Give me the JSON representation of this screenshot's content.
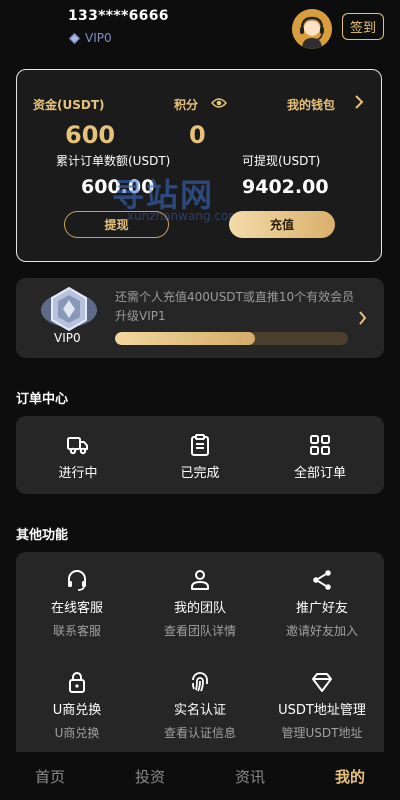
{
  "header": {
    "phone": "133****6666",
    "vip_level": "VIP0",
    "signin_label": "签到"
  },
  "assets": {
    "funds_label": "资金(USDT)",
    "funds_value": "600",
    "points_label": "积分",
    "points_value": "0",
    "wallet_label": "我的钱包",
    "total_orders_label": "累计订单数额(USDT)",
    "total_orders_value": "600.00",
    "withdrawable_label": "可提现(USDT)",
    "withdrawable_value": "9402.00",
    "withdraw_button": "提现",
    "recharge_button": "充值",
    "watermark": "寻站网",
    "watermark_sub": "xunzhanwang.com"
  },
  "vip_card": {
    "level": "VIP0",
    "description": "还需个人充值400USDT或直推10个有效会员升级VIP1",
    "progress": 0.6
  },
  "orders": {
    "title": "订单中心",
    "items": [
      {
        "label": "进行中",
        "icon": "truck-icon"
      },
      {
        "label": "已完成",
        "icon": "clipboard-icon"
      },
      {
        "label": "全部订单",
        "icon": "grid-icon"
      }
    ]
  },
  "functions": {
    "title": "其他功能",
    "items": [
      {
        "label": "在线客服",
        "sub": "联系客服",
        "icon": "headset-icon"
      },
      {
        "label": "我的团队",
        "sub": "查看团队详情",
        "icon": "user-icon"
      },
      {
        "label": "推广好友",
        "sub": "邀请好友加入",
        "icon": "share-icon"
      },
      {
        "label": "U商兑换",
        "sub": "U商兑换",
        "icon": "lock-icon"
      },
      {
        "label": "实名认证",
        "sub": "查看认证信息",
        "icon": "fingerprint-icon"
      },
      {
        "label": "USDT地址管理",
        "sub": "管理USDT地址",
        "icon": "diamond-icon"
      }
    ]
  },
  "tabbar": {
    "items": [
      "首页",
      "投资",
      "资讯",
      "我的"
    ],
    "active": "我的"
  },
  "colors": {
    "accent": "#e7c27a",
    "background": "#0d0d0d",
    "card": "#262626"
  }
}
